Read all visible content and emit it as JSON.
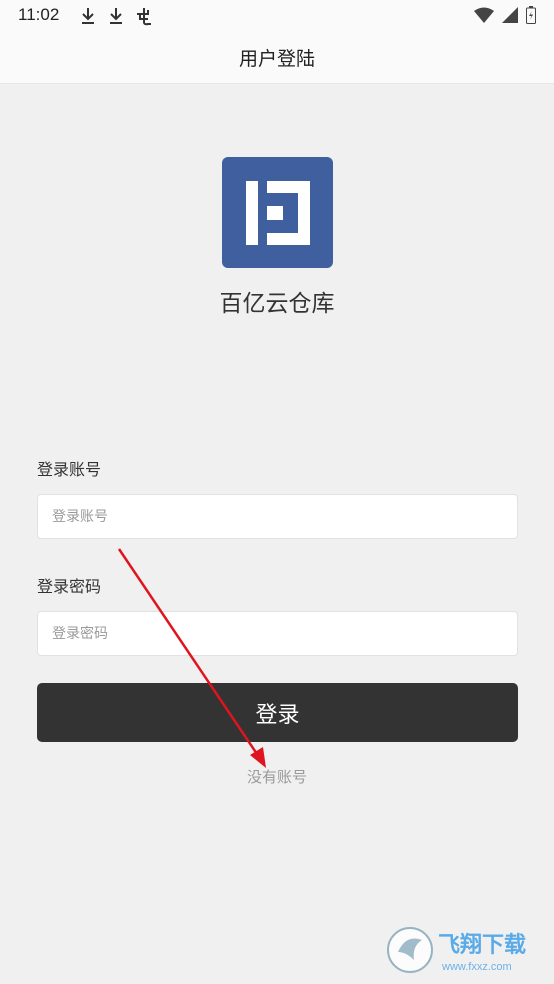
{
  "status_bar": {
    "time": "11:02",
    "left_icons": [
      "download-icon",
      "download-icon",
      "notification-icon"
    ],
    "right_icons": [
      "wifi-icon",
      "signal-icon",
      "battery-icon"
    ]
  },
  "header": {
    "title": "用户登陆"
  },
  "logo": {
    "icon": "app-logo-icon",
    "color": "#3f5f9f"
  },
  "app_name": "百亿云仓库",
  "form": {
    "account_label": "登录账号",
    "account_placeholder": "登录账号",
    "account_value": "",
    "password_label": "登录密码",
    "password_placeholder": "登录密码",
    "password_value": "",
    "login_button": "登录",
    "register_link": "没有账号"
  },
  "annotation": {
    "icon": "red-arrow-icon",
    "color": "#e0141e"
  },
  "watermark": {
    "text": "飞翔下载",
    "subtext": "www.fxxz.com"
  }
}
